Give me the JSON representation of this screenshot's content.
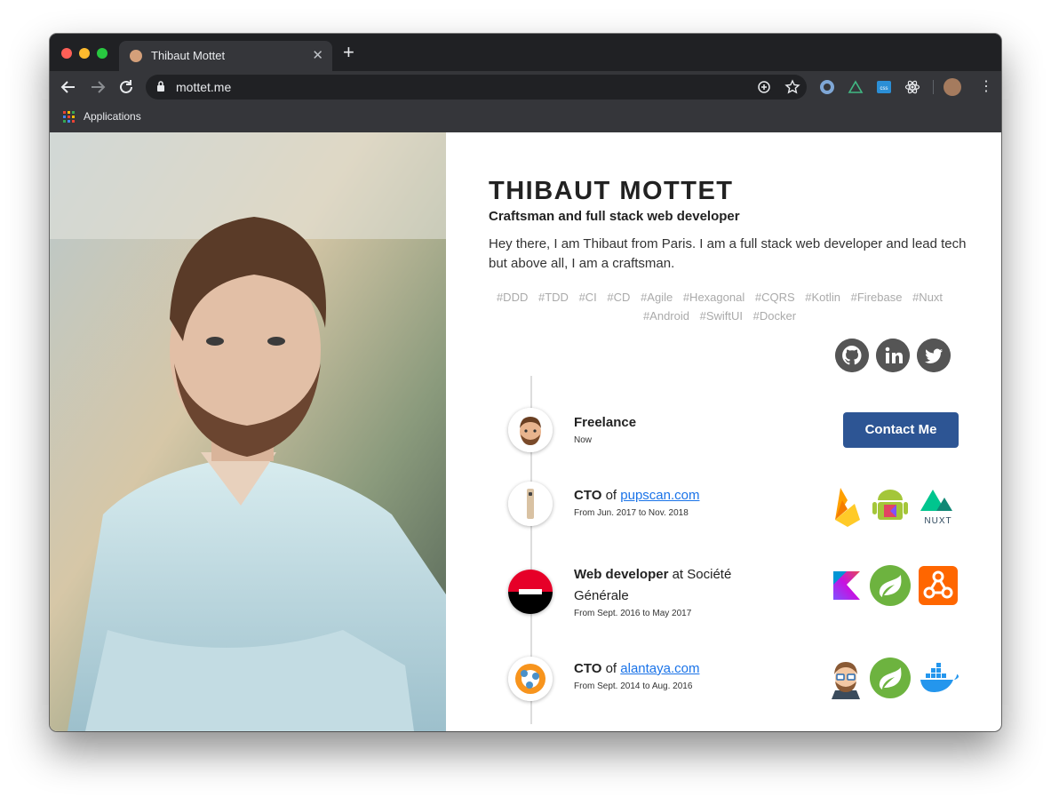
{
  "browser": {
    "tab_title": "Thibaut Mottet",
    "url": "mottet.me",
    "bookmark_label": "Applications",
    "extensions": [
      "circle-extension-icon",
      "vue-devtools-icon",
      "css-extension-icon",
      "react-devtools-icon"
    ]
  },
  "profile": {
    "name": "THIBAUT MOTTET",
    "subtitle": "Craftsman and full stack web developer",
    "bio": "Hey there, I am Thibaut from Paris. I am a full stack web developer and lead tech but above all, I am a craftsman.",
    "tags": [
      "#DDD",
      "#TDD",
      "#CI",
      "#CD",
      "#Agile",
      "#Hexagonal",
      "#CQRS",
      "#Kotlin",
      "#Firebase",
      "#Nuxt",
      "#Android",
      "#SwiftUI",
      "#Docker"
    ],
    "social": [
      "github-icon",
      "linkedin-icon",
      "twitter-icon"
    ],
    "contact_label": "Contact Me"
  },
  "timeline": [
    {
      "title": "Freelance",
      "dates": "Now"
    },
    {
      "title": "CTO",
      "connector": "of",
      "link": "pupscan.com",
      "dates": "From Jun. 2017 to Nov. 2018",
      "tech": [
        "firebase-icon",
        "android-kotlin-icon",
        "nuxt-icon"
      ],
      "tech_text": "NUXT"
    },
    {
      "title": "Web developer",
      "connector": "at Société Générale",
      "dates": "From Sept. 2016 to May 2017",
      "tech": [
        "kotlin-icon",
        "spring-icon",
        "rabbitmq-icon"
      ]
    },
    {
      "title": "CTO",
      "connector": "of",
      "link": "alantaya.com",
      "dates": "From Sept. 2014 to Aug. 2016",
      "tech": [
        "jhipster-icon",
        "spring-icon",
        "docker-icon"
      ]
    }
  ],
  "colors": {
    "accent": "#2d5594",
    "link": "#1a73e8",
    "social": "#555555"
  }
}
